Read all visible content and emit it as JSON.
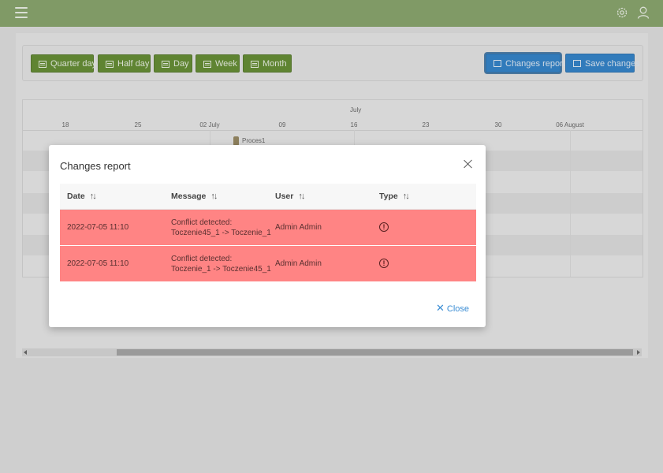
{
  "toolbar_buttons": {
    "quarter_day": "Quarter day",
    "half_day": "Half day",
    "day": "Day",
    "week": "Week",
    "month": "Month",
    "changes_report": "Changes report",
    "save_changes": "Save changes"
  },
  "gantt": {
    "month": "July",
    "days": [
      "18",
      "25",
      "02 July",
      "09",
      "16",
      "23",
      "30",
      "06 August"
    ],
    "task_label": "Proces1"
  },
  "modal": {
    "title": "Changes report",
    "close_label": "Close",
    "columns": [
      "Date",
      "Message",
      "User",
      "Type"
    ],
    "rows": [
      {
        "date": "2022-07-05 11:10",
        "message_line1": "Conflict detected:",
        "message_line2": "Toczenie45_1 -> Toczenie_1",
        "user": "Admin Admin",
        "type": "!"
      },
      {
        "date": "2022-07-05 11:10",
        "message_line1": "Conflict detected:",
        "message_line2": "Toczenie_1 -> Toczenie45_1",
        "user": "Admin Admin",
        "type": "!"
      }
    ]
  },
  "colors": {
    "topbar": "#7c9b5c",
    "green_button": "#53801d",
    "blue_button": "#1c76c4",
    "error_row": "#ff8484",
    "link": "#3b8dd4"
  }
}
